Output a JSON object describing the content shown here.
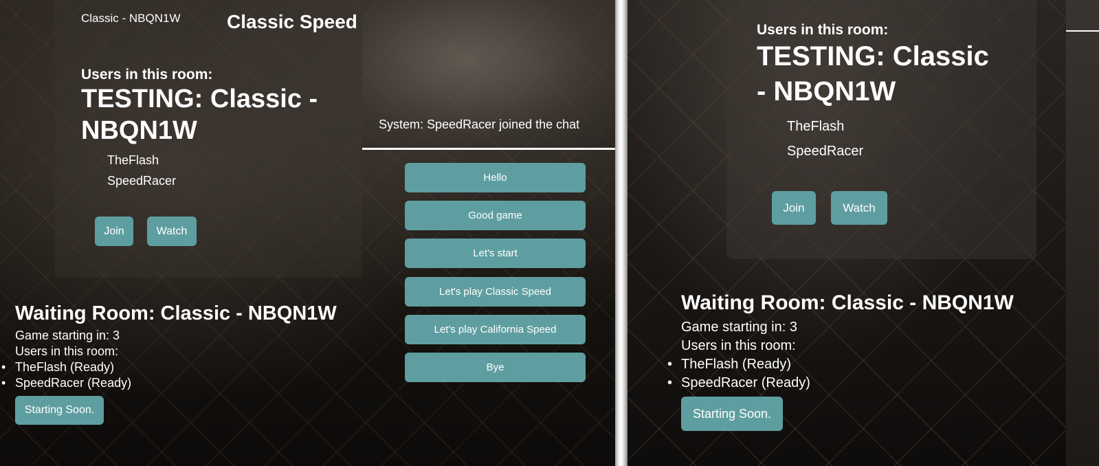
{
  "left": {
    "room_code_header": "Classic - NBQN1W",
    "mode_title": "Classic Speed",
    "users_label": "Users in this room:",
    "room_title_line1": "TESTING: Classic -",
    "room_title_line2": "NBQN1W",
    "users": [
      "TheFlash",
      "SpeedRacer"
    ],
    "join_label": "Join",
    "watch_label": "Watch",
    "waiting": {
      "title": "Waiting Room: Classic - NBQN1W",
      "countdown": "Game starting in: 3",
      "users_label": "Users in this room:",
      "users": [
        "TheFlash (Ready)",
        "SpeedRacer (Ready)"
      ],
      "status_button": "Starting Soon."
    }
  },
  "chat": {
    "last_message": "System: SpeedRacer joined the chat",
    "quick_replies": [
      "Hello",
      "Good game",
      "Let's start",
      "Let's play Classic Speed",
      "Let's play California Speed",
      "Bye"
    ]
  },
  "right": {
    "users_label": "Users in this room:",
    "room_title_line1": "TESTING: Classic",
    "room_title_line2": "- NBQN1W",
    "users": [
      "TheFlash",
      "SpeedRacer"
    ],
    "join_label": "Join",
    "watch_label": "Watch",
    "waiting": {
      "title": "Waiting Room: Classic - NBQN1W",
      "countdown": "Game starting in: 3",
      "users_label": "Users in this room:",
      "users": [
        "TheFlash (Ready)",
        "SpeedRacer (Ready)"
      ],
      "status_button": "Starting Soon."
    }
  },
  "colors": {
    "accent": "#5f9ea0",
    "text": "#ffffff"
  }
}
